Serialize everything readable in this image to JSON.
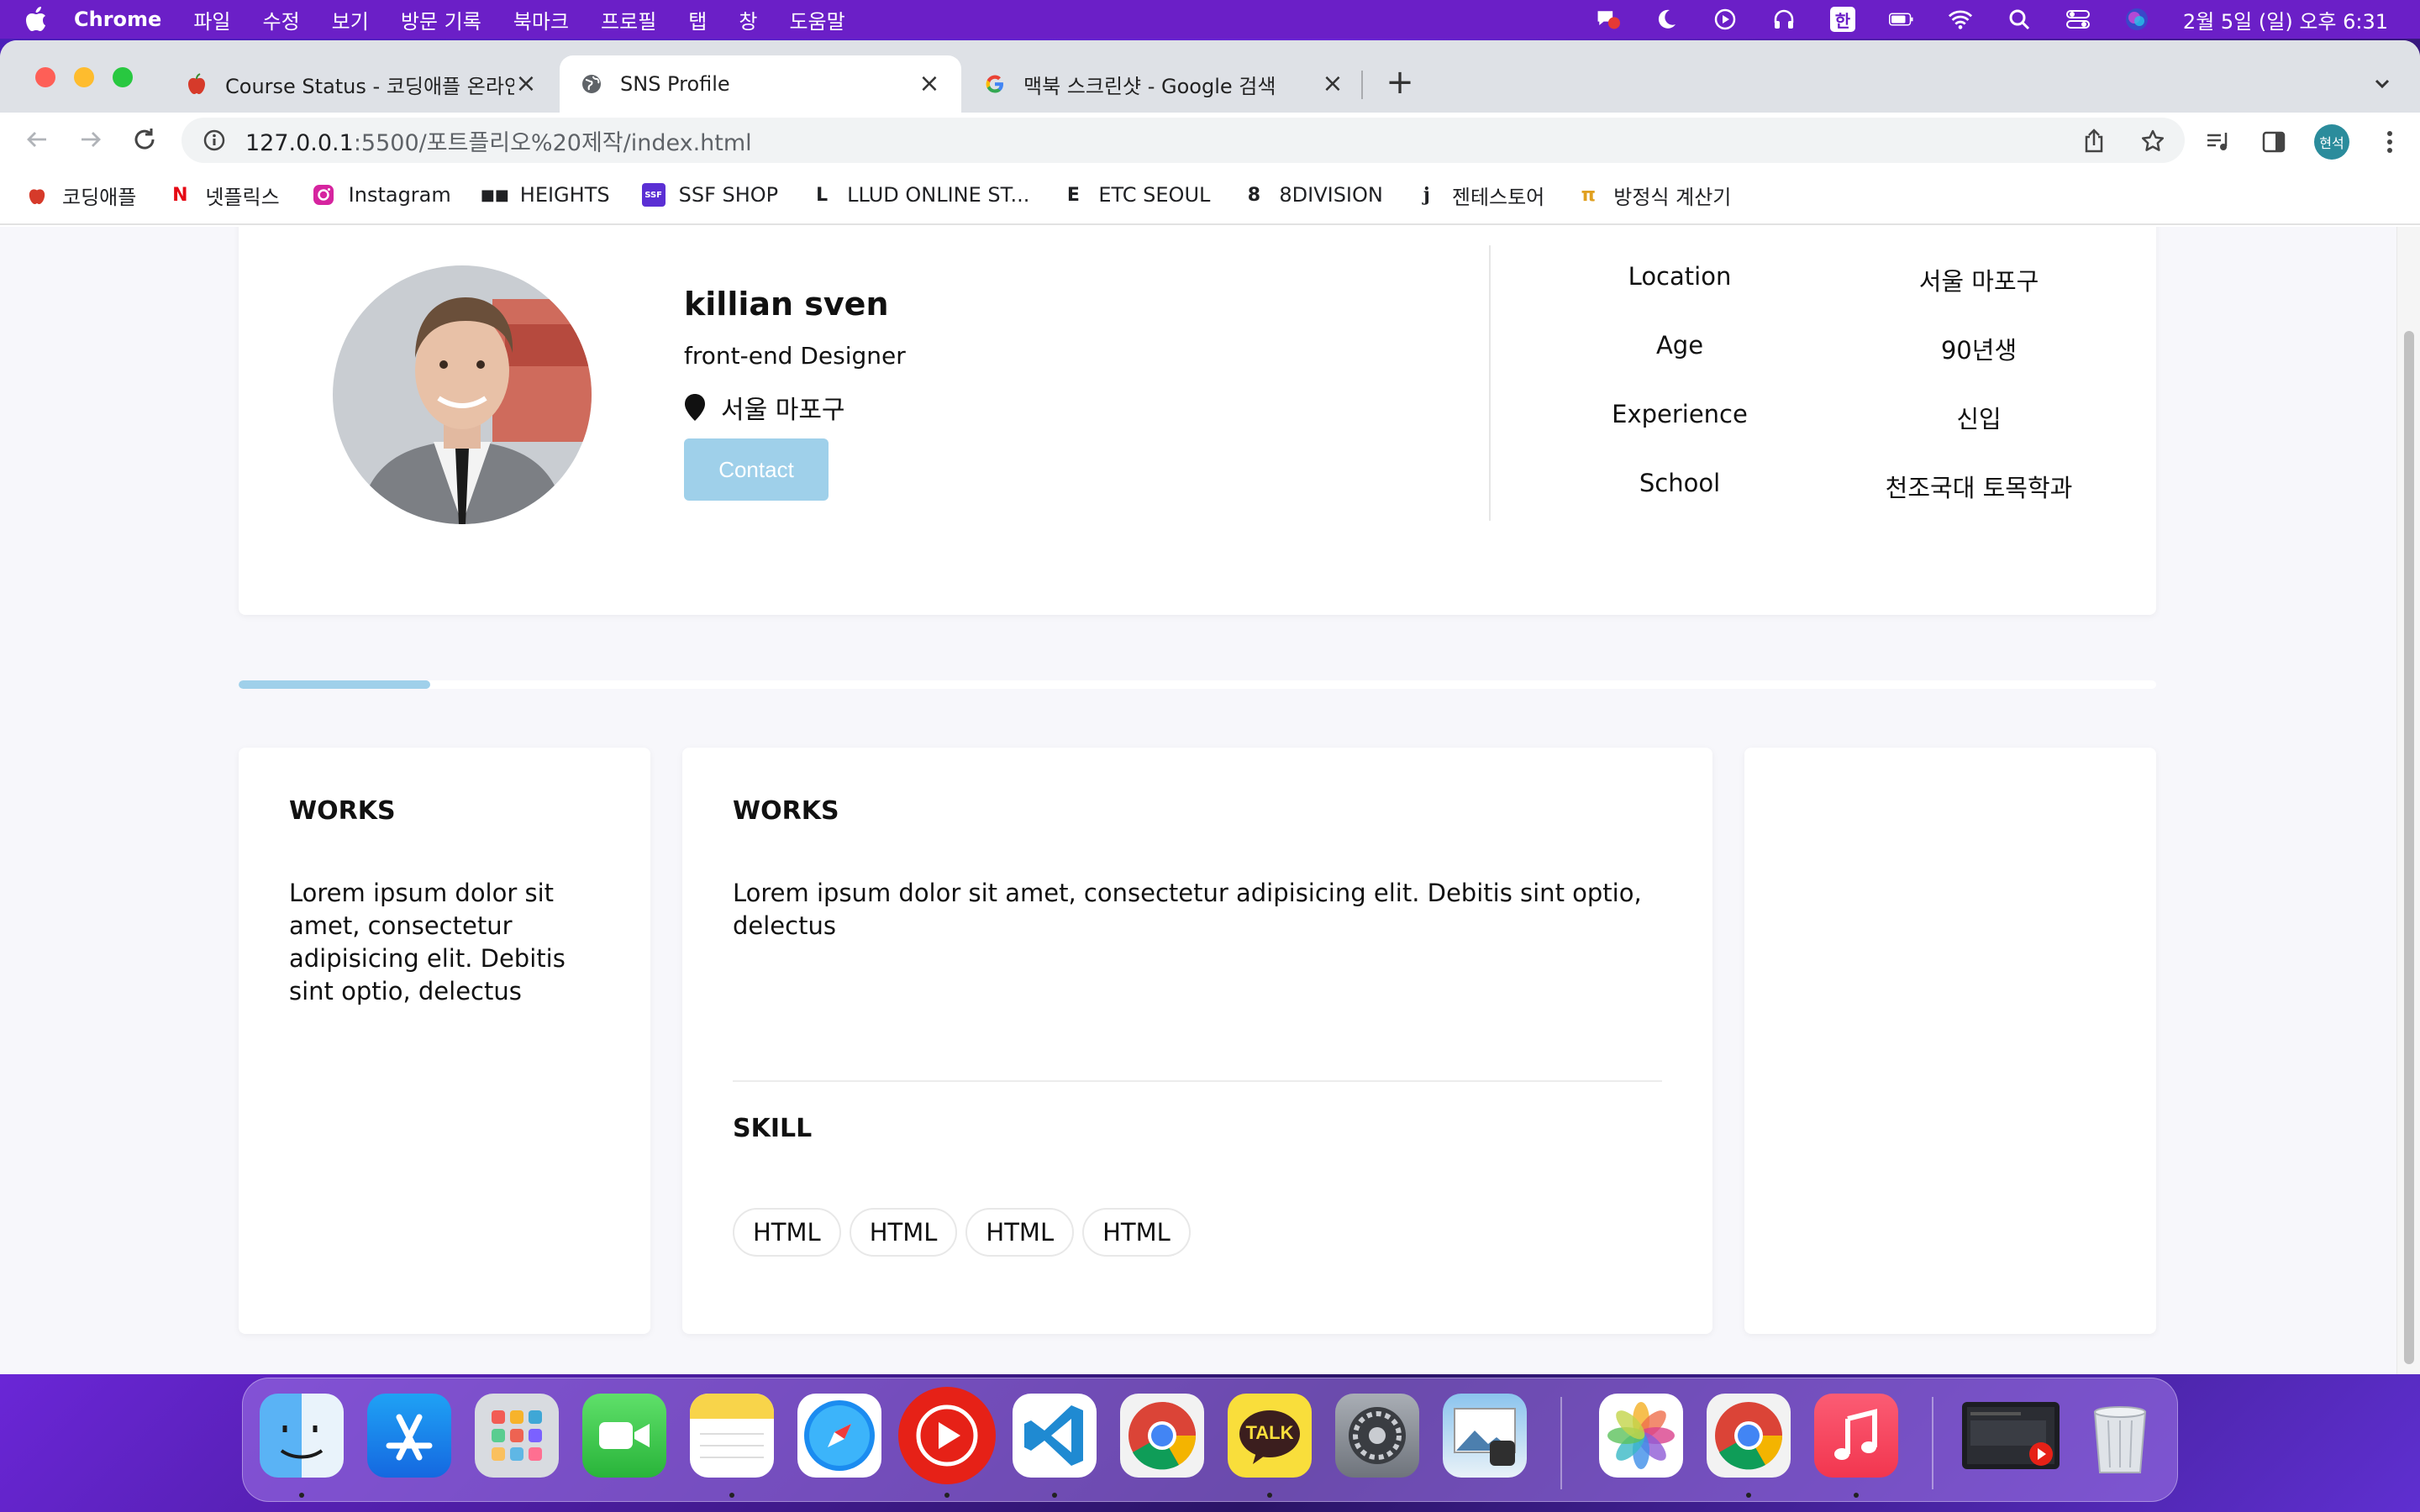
{
  "menubar": {
    "app_name": "Chrome",
    "items": [
      "파일",
      "수정",
      "보기",
      "방문 기록",
      "북마크",
      "프로필",
      "탭",
      "창",
      "도움말"
    ],
    "clock": "2월 5일 (일) 오후 6:31",
    "input_mode": "한"
  },
  "tabs": [
    {
      "title": "Course Status - 코딩애플 온라인",
      "favicon": "apple-favicon"
    },
    {
      "title": "SNS Profile",
      "favicon": "globe-icon"
    },
    {
      "title": "맥북 스크린샷 - Google 검색",
      "favicon": "google-icon"
    }
  ],
  "address_bar": {
    "host": "127.0.0.1",
    "path": ":5500/포트플리오%20제작/index.html"
  },
  "profile_chip": "현석",
  "bookmarks": [
    {
      "label": "코딩애플",
      "icon": "apple-icon"
    },
    {
      "label": "넷플릭스",
      "icon": "netflix-icon"
    },
    {
      "label": "Instagram",
      "icon": "instagram-icon"
    },
    {
      "label": "HEIGHTS",
      "icon": "heights-icon"
    },
    {
      "label": "SSF SHOP",
      "icon": "ssf-icon"
    },
    {
      "label": "LLUD ONLINE ST...",
      "icon": "llud-icon"
    },
    {
      "label": "ETC SEOUL",
      "icon": "etc-icon"
    },
    {
      "label": "8DIVISION",
      "icon": "8division-icon"
    },
    {
      "label": "젠테스토어",
      "icon": "jente-icon"
    },
    {
      "label": "방정식 계산기",
      "icon": "pi-icon"
    }
  ],
  "profile": {
    "name": "killian sven",
    "role": "front-end Designer",
    "location": "서울 마포구",
    "contact_label": "Contact",
    "info": [
      {
        "key": "Location",
        "value": "서울 마포구"
      },
      {
        "key": "Age",
        "value": "90년생"
      },
      {
        "key": "Experience",
        "value": "신입"
      },
      {
        "key": "School",
        "value": "천조국대 토목학과"
      }
    ]
  },
  "progress": {
    "fraction": 0.1
  },
  "works_card": {
    "title": "WORKS",
    "body": "Lorem ipsum dolor sit amet, consectetur adipisicing elit. Debitis sint optio, delectus"
  },
  "main_card": {
    "title": "WORKS",
    "body": "Lorem ipsum dolor sit amet, consectetur adipisicing elit. Debitis sint optio, delectus",
    "skill_title": "SKILL",
    "skills": [
      "HTML",
      "HTML",
      "HTML",
      "HTML"
    ]
  },
  "dock": {
    "apps": [
      "finder-icon",
      "app-store-icon",
      "launchpad-icon",
      "facetime-icon",
      "notes-icon",
      "safari-icon",
      "youtube-music-icon",
      "vscode-icon",
      "chrome-icon",
      "kakaotalk-icon",
      "system-settings-icon",
      "preview-icon",
      "photos-icon",
      "chrome-icon",
      "music-icon",
      "screen-recording-icon",
      "trash-icon"
    ],
    "kakao_label": "TALK"
  },
  "colors": {
    "accent": "#9fd0ea",
    "menubar": "#6b1fc7",
    "page_bg": "#f7f7fb"
  }
}
